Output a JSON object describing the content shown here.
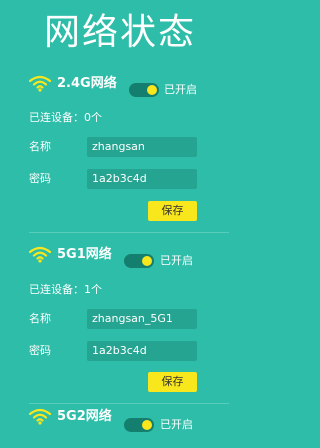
{
  "page": {
    "title": "网络状态"
  },
  "networks": [
    {
      "name": "2.4G网络",
      "toggle_label": "已开启",
      "devices": "已连设备：0个",
      "ssid_label": "名称",
      "ssid_value": "zhangsan",
      "password_label": "密码",
      "password_value": "1a2b3c4d",
      "save_label": "保存"
    },
    {
      "name": "5G1网络",
      "toggle_label": "已开启",
      "devices": "已连设备：1个",
      "ssid_label": "名称",
      "ssid_value": "zhangsan_5G1",
      "password_label": "密码",
      "password_value": "1a2b3c4d",
      "save_label": "保存"
    },
    {
      "name": "5G2网络",
      "toggle_label": "已开启"
    }
  ],
  "colors": {
    "background": "#2dbda8",
    "accent": "#f8e71c",
    "field": "#25a591"
  },
  "icons": [
    "wifi-icon"
  ]
}
